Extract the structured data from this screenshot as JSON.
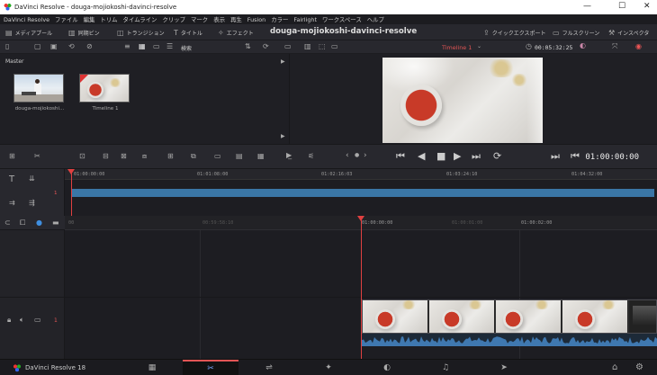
{
  "window": {
    "title": "DaVinci Resolve - douga-mojiokoshi-davinci-resolve",
    "controls": {
      "minimize": "—",
      "maximize": "☐",
      "close": "✕"
    }
  },
  "menu": [
    "DaVinci Resolve",
    "ファイル",
    "編集",
    "トリム",
    "タイムライン",
    "クリップ",
    "マーク",
    "表示",
    "再生",
    "Fusion",
    "カラー",
    "Fairlight",
    "ワークスペース",
    "ヘルプ"
  ],
  "toolbar": {
    "media_pool": "メディアプール",
    "sync_bin": "同期ビン",
    "transitions": "トランジション",
    "titles": "タイトル",
    "effects": "エフェクト",
    "project_title": "douga-mojiokoshi-davinci-resolve",
    "quick_export": "クイックエクスポート",
    "fullscreen": "フルスクリーン",
    "inspector": "インスペクタ"
  },
  "media_pool": {
    "search_label": "検索",
    "bin_label": "Master",
    "clips": [
      {
        "name": "douga-mojiokoshi...",
        "type": "video"
      },
      {
        "name": "Timeline 1",
        "type": "timeline"
      }
    ]
  },
  "viewer": {
    "timeline_name": "Timeline 1",
    "source_timecode": "00:05:32:25",
    "record_timecode": "01:00:00:00"
  },
  "mini_timeline": {
    "ruler": [
      "01:00:00:00",
      "01:01:08:00",
      "01:02:16:03",
      "01:03:24:10",
      "01:04:32:00"
    ],
    "track_number": "1"
  },
  "timeline": {
    "ruler": [
      "00",
      "01:00:00:00",
      "01:00:01:00",
      "01:00:02:00"
    ],
    "ruler_faded": "00:59:58:10",
    "track_number": "1"
  },
  "bottombar": {
    "app_name": "DaVinci Resolve 18",
    "pages": [
      {
        "name": "media",
        "icon": "▦"
      },
      {
        "name": "cut",
        "icon": "✂"
      },
      {
        "name": "edit",
        "icon": "⇌"
      },
      {
        "name": "fusion",
        "icon": "✦"
      },
      {
        "name": "color",
        "icon": "◐"
      },
      {
        "name": "fairlight",
        "icon": "♫"
      },
      {
        "name": "deliver",
        "icon": "➤"
      }
    ],
    "home_icon": "⌂",
    "settings_icon": "⚙"
  },
  "colors": {
    "playhead": "#e04040",
    "track_blue": "#3a76a6",
    "timeline_red": "#e25555",
    "audio_wave": "#3f78b0"
  }
}
